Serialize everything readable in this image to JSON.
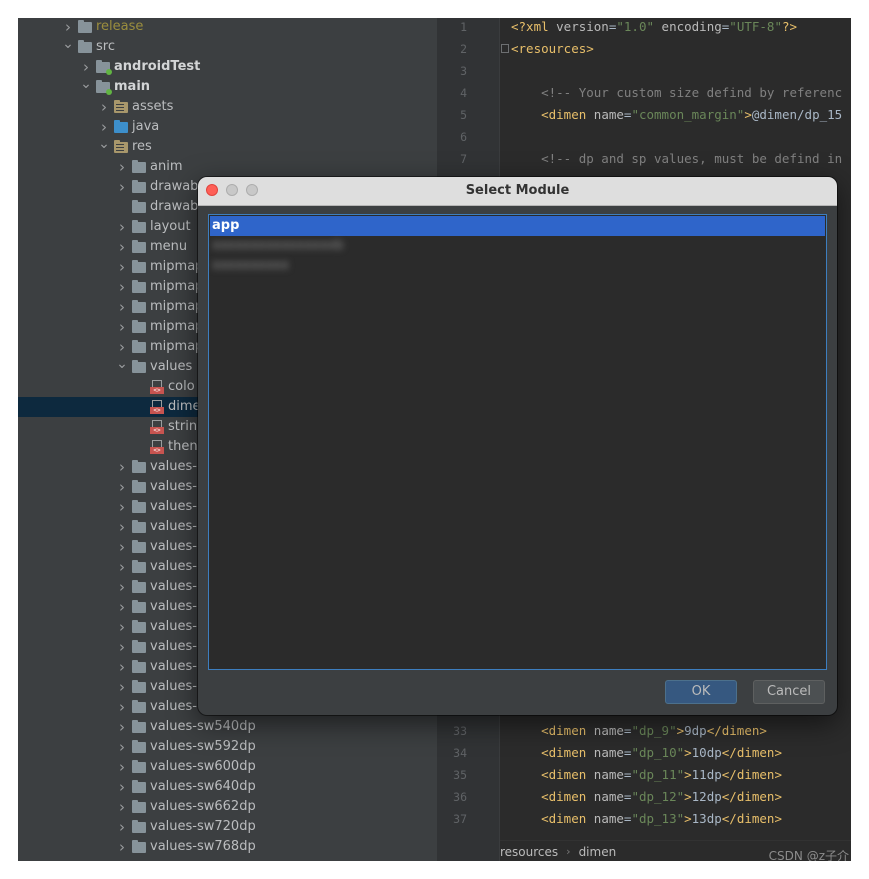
{
  "tree": {
    "items": [
      {
        "label": "release",
        "style": "excluded",
        "icon": "folder-icon",
        "chevron": "right"
      },
      {
        "label": "src",
        "style": "normal",
        "icon": "folder-icon",
        "chevron": "down"
      },
      {
        "label": "androidTest",
        "style": "bold",
        "icon": "module-folder-icon",
        "chevron": "right"
      },
      {
        "label": "main",
        "style": "bold",
        "icon": "module-folder-icon",
        "chevron": "down"
      },
      {
        "label": "assets",
        "style": "normal",
        "icon": "resource-folder-icon",
        "chevron": "right"
      },
      {
        "label": "java",
        "style": "normal",
        "icon": "source-folder-icon",
        "chevron": "right"
      },
      {
        "label": "res",
        "style": "normal",
        "icon": "resource-folder-icon",
        "chevron": "down"
      },
      {
        "label": "anim",
        "style": "normal",
        "icon": "folder-icon",
        "chevron": "right"
      },
      {
        "label": "drawab",
        "style": "normal",
        "icon": "folder-icon",
        "chevron": "right"
      },
      {
        "label": "drawab",
        "style": "normal",
        "icon": "folder-icon",
        "chevron": "none"
      },
      {
        "label": "layout",
        "style": "normal",
        "icon": "folder-icon",
        "chevron": "right"
      },
      {
        "label": "menu",
        "style": "normal",
        "icon": "folder-icon",
        "chevron": "right"
      },
      {
        "label": "mipmap",
        "style": "normal",
        "icon": "folder-icon",
        "chevron": "right"
      },
      {
        "label": "mipmap",
        "style": "normal",
        "icon": "folder-icon",
        "chevron": "right"
      },
      {
        "label": "mipmap",
        "style": "normal",
        "icon": "folder-icon",
        "chevron": "right"
      },
      {
        "label": "mipmap",
        "style": "normal",
        "icon": "folder-icon",
        "chevron": "right"
      },
      {
        "label": "mipmap",
        "style": "normal",
        "icon": "folder-icon",
        "chevron": "right"
      },
      {
        "label": "values",
        "style": "normal",
        "icon": "folder-icon",
        "chevron": "down"
      },
      {
        "label": "colo",
        "style": "normal",
        "icon": "xml-file-icon",
        "chevron": "none"
      },
      {
        "label": "dime",
        "style": "selected",
        "icon": "xml-file-icon",
        "chevron": "none"
      },
      {
        "label": "strin",
        "style": "normal",
        "icon": "xml-file-icon",
        "chevron": "none"
      },
      {
        "label": "then",
        "style": "normal",
        "icon": "xml-file-icon",
        "chevron": "none"
      },
      {
        "label": "values-",
        "style": "normal",
        "icon": "folder-icon",
        "chevron": "right"
      },
      {
        "label": "values-",
        "style": "normal",
        "icon": "folder-icon",
        "chevron": "right"
      },
      {
        "label": "values-",
        "style": "normal",
        "icon": "folder-icon",
        "chevron": "right"
      },
      {
        "label": "values-",
        "style": "normal",
        "icon": "folder-icon",
        "chevron": "right"
      },
      {
        "label": "values-",
        "style": "normal",
        "icon": "folder-icon",
        "chevron": "right"
      },
      {
        "label": "values-",
        "style": "normal",
        "icon": "folder-icon",
        "chevron": "right"
      },
      {
        "label": "values-",
        "style": "normal",
        "icon": "folder-icon",
        "chevron": "right"
      },
      {
        "label": "values-",
        "style": "normal",
        "icon": "folder-icon",
        "chevron": "right"
      },
      {
        "label": "values-",
        "style": "normal",
        "icon": "folder-icon",
        "chevron": "right"
      },
      {
        "label": "values-",
        "style": "normal",
        "icon": "folder-icon",
        "chevron": "right"
      },
      {
        "label": "values-",
        "style": "normal",
        "icon": "folder-icon",
        "chevron": "right"
      },
      {
        "label": "values-",
        "style": "normal",
        "icon": "folder-icon",
        "chevron": "right"
      },
      {
        "label": "values-",
        "style": "normal",
        "icon": "folder-icon",
        "chevron": "right"
      },
      {
        "label": "values-sw540dp",
        "style": "normal",
        "icon": "folder-icon",
        "chevron": "right"
      },
      {
        "label": "values-sw592dp",
        "style": "normal",
        "icon": "folder-icon",
        "chevron": "right"
      },
      {
        "label": "values-sw600dp",
        "style": "normal",
        "icon": "folder-icon",
        "chevron": "right"
      },
      {
        "label": "values-sw640dp",
        "style": "normal",
        "icon": "folder-icon",
        "chevron": "right"
      },
      {
        "label": "values-sw662dp",
        "style": "normal",
        "icon": "folder-icon",
        "chevron": "right"
      },
      {
        "label": "values-sw720dp",
        "style": "normal",
        "icon": "folder-icon",
        "chevron": "right"
      },
      {
        "label": "values-sw768dp",
        "style": "normal",
        "icon": "folder-icon",
        "chevron": "right"
      }
    ],
    "depths": [
      2,
      2,
      3,
      3,
      4,
      4,
      4,
      5,
      5,
      5,
      5,
      5,
      5,
      5,
      5,
      5,
      5,
      5,
      6,
      6,
      6,
      6,
      5,
      5,
      5,
      5,
      5,
      5,
      5,
      5,
      5,
      5,
      5,
      5,
      5,
      5,
      5,
      5,
      5,
      5,
      5,
      5
    ]
  },
  "editor": {
    "lines": [
      {
        "n": "1",
        "tokens": [
          [
            "tag",
            "<?xml "
          ],
          [
            "attr",
            "version"
          ],
          [
            "txt",
            "="
          ],
          [
            "str",
            "\"1.0\""
          ],
          [
            "txt",
            " "
          ],
          [
            "attr",
            "encoding"
          ],
          [
            "txt",
            "="
          ],
          [
            "str",
            "\"UTF-8\""
          ],
          [
            "tag",
            "?>"
          ]
        ]
      },
      {
        "n": "2",
        "tokens": [
          [
            "tag",
            "<resources>"
          ]
        ]
      },
      {
        "n": "3",
        "tokens": []
      },
      {
        "n": "4",
        "tokens": [
          [
            "comment",
            "    <!-- Your custom size defind by referenc"
          ]
        ]
      },
      {
        "n": "5",
        "tokens": [
          [
            "tag",
            "    <dimen "
          ],
          [
            "attr",
            "name"
          ],
          [
            "txt",
            "="
          ],
          [
            "str",
            "\"common_margin\""
          ],
          [
            "tag",
            ">"
          ],
          [
            "txt",
            "@dimen/dp_15"
          ]
        ]
      },
      {
        "n": "6",
        "tokens": []
      },
      {
        "n": "7",
        "tokens": [
          [
            "comment",
            "    <!-- dp and sp values, must be defind in"
          ]
        ]
      },
      {
        "n": "33",
        "tokens": [
          [
            "tag",
            "    <dimen "
          ],
          [
            "attr",
            "name"
          ],
          [
            "txt",
            "="
          ],
          [
            "str",
            "\"dp_9\""
          ],
          [
            "tag",
            ">"
          ],
          [
            "txt",
            "9dp"
          ],
          [
            "tag",
            "</dimen>"
          ]
        ]
      },
      {
        "n": "34",
        "tokens": [
          [
            "tag",
            "    <dimen "
          ],
          [
            "attr",
            "name"
          ],
          [
            "txt",
            "="
          ],
          [
            "str",
            "\"dp_10\""
          ],
          [
            "tag",
            ">"
          ],
          [
            "txt",
            "10dp"
          ],
          [
            "tag",
            "</dimen>"
          ]
        ]
      },
      {
        "n": "35",
        "tokens": [
          [
            "tag",
            "    <dimen "
          ],
          [
            "attr",
            "name"
          ],
          [
            "txt",
            "="
          ],
          [
            "str",
            "\"dp_11\""
          ],
          [
            "tag",
            ">"
          ],
          [
            "txt",
            "11dp"
          ],
          [
            "tag",
            "</dimen>"
          ]
        ]
      },
      {
        "n": "36",
        "tokens": [
          [
            "tag",
            "    <dimen "
          ],
          [
            "attr",
            "name"
          ],
          [
            "txt",
            "="
          ],
          [
            "str",
            "\"dp_12\""
          ],
          [
            "tag",
            ">"
          ],
          [
            "txt",
            "12dp"
          ],
          [
            "tag",
            "</dimen>"
          ]
        ]
      },
      {
        "n": "37",
        "tokens": [
          [
            "tag",
            "    <dimen "
          ],
          [
            "attr",
            "name"
          ],
          [
            "txt",
            "="
          ],
          [
            "str",
            "\"dp_13\""
          ],
          [
            "tag",
            ">"
          ],
          [
            "txt",
            "13dp"
          ],
          [
            "tag",
            "</dimen>"
          ]
        ]
      }
    ],
    "breadcrumbs": [
      "resources",
      "dimen"
    ],
    "watermark": "CSDN @z子介"
  },
  "dialog": {
    "title": "Select Module",
    "items": [
      {
        "label": "app",
        "selected": true,
        "blurred": false
      },
      {
        "label": "xxxxxxxxxxxxxxxxb",
        "selected": false,
        "blurred": true
      },
      {
        "label": "xxxxxxxxxx",
        "selected": false,
        "blurred": true
      }
    ],
    "ok_label": "OK",
    "cancel_label": "Cancel"
  }
}
